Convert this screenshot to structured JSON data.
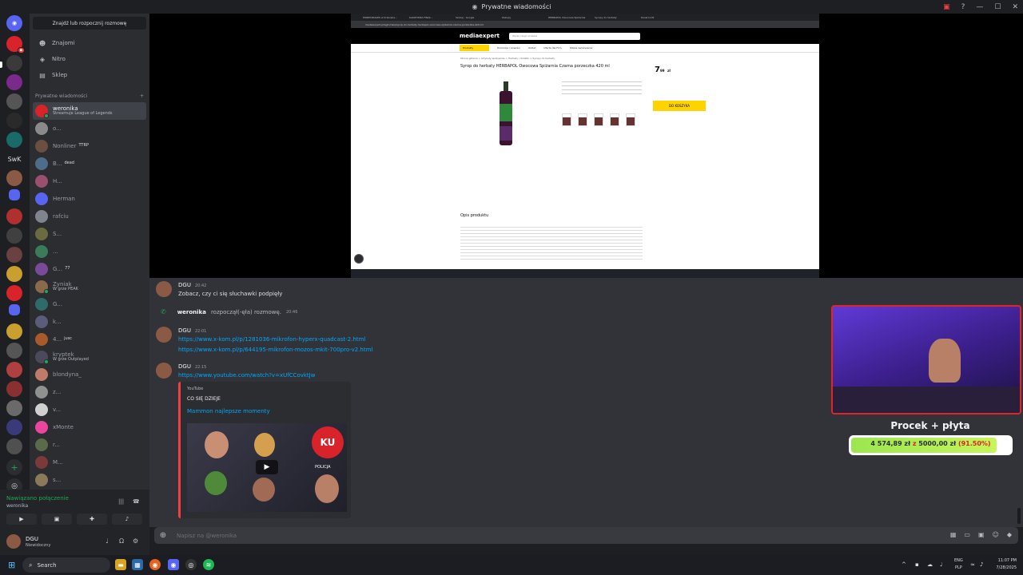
{
  "window": {
    "title": "Prywatne wiadomości"
  },
  "sidebar": {
    "search_label": "Znajdź lub rozpocznij rozmowę",
    "nav": [
      {
        "label": "Znajomi",
        "icon": "friends-icon"
      },
      {
        "label": "Nitro",
        "icon": "nitro-icon"
      },
      {
        "label": "Sklep",
        "icon": "shop-icon"
      }
    ],
    "dm_header": "Prywatne wiadomości",
    "dms": [
      {
        "name": "weronika",
        "sub": "Streamuje League of Legends",
        "active": true,
        "color": "#d8232a"
      },
      {
        "name": "o...",
        "color": "#8a8a8a"
      },
      {
        "name": "Nonliner",
        "tag": "TTRP",
        "color": "#6b4f3f"
      },
      {
        "name": "B...",
        "tag": "dead",
        "color": "#4e6d8a"
      },
      {
        "name": "H...",
        "color": "#9a4f6e"
      },
      {
        "name": "Herman",
        "color": "#5865f2"
      },
      {
        "name": "rafciu",
        "color": "#80848e"
      },
      {
        "name": "S...",
        "color": "#6b6b40"
      },
      {
        "name": "...",
        "color": "#3b7b5a"
      },
      {
        "name": "G...",
        "tag": "77",
        "color": "#7a4a9a"
      },
      {
        "name": "Zyniak",
        "sub": "W grze PEAK",
        "color": "#8a6a4a"
      },
      {
        "name": "G...",
        "color": "#2e6b6b"
      },
      {
        "name": "k...",
        "color": "#5b5b7a"
      },
      {
        "name": "4...",
        "tag": "jusc",
        "color": "#a85a2a"
      },
      {
        "name": "kryptek",
        "sub": "W grze Outplayed",
        "color": "#4a4a5a"
      },
      {
        "name": "blondyna_",
        "color": "#c07a6a"
      },
      {
        "name": "z...",
        "color": "#909090"
      },
      {
        "name": "v...",
        "color": "#d0d0d0"
      },
      {
        "name": "xMonte",
        "color": "#eb459e"
      },
      {
        "name": "r...",
        "color": "#5a6a4a"
      },
      {
        "name": "M...",
        "color": "#7a3a3a"
      },
      {
        "name": "s...",
        "color": "#8a7a5a"
      }
    ]
  },
  "voice": {
    "status": "Nawiązano połączenie",
    "channel": "weronika"
  },
  "user": {
    "name": "DGU",
    "status": "Niewidoczny"
  },
  "stream": {
    "tabs": [
      "PONIEDZIAŁEK w Krakowie...",
      "KAKOFONIA FINAŁ...",
      "Szukaj - Google",
      "Zakupy",
      "HERBAPOL Owocowa Spiżarnia",
      "Syropy do herbaty",
      "Kanał Łódź"
    ],
    "url": "mediaexpert.pl/agd-male/syrop-do-herbaty-herbapol-owocowa-spizarnia-czarna-porzeczka-420-ml",
    "shop": {
      "logo": "mediaexpert",
      "search_placeholder": "Wpisz czego szukasz",
      "category_button": "Produkty",
      "nav": [
        "Promocje i nowości",
        "Outlet",
        "Oferta dla Firm",
        "Status zamówienia"
      ],
      "breadcrumb": "Strona główna > Artykuły spożywcze > Herbaty i dodatki > Syropy do herbaty",
      "product_title": "Syrop do herbaty HERBAPOL Owocowa Spiżarnia Czarna porzeczka 420 ml",
      "price": "7",
      "price_cents": "99",
      "price_currency": "zł",
      "cart_button": "DO KOSZYKA",
      "description_title": "Opis produktu"
    }
  },
  "chat": {
    "messages": [
      {
        "author": "DGU",
        "time": "20:42",
        "text": "Zobacz, czy ci się słuchawki podpięły"
      },
      {
        "author": "DGU",
        "time": "22:01",
        "links": [
          "https://www.x-kom.pl/p/1281036-mikrofon-hyperx-quadcast-2.html",
          "https://www.x-kom.pl/p/644195-mikrofon-mozos-mkit-700pro-v2.html"
        ]
      },
      {
        "author": "DGU",
        "time": "22:15",
        "links": [
          "https://www.youtube.com/watch?v=xUfCCovktJw"
        ]
      }
    ],
    "call": {
      "who": "weronika",
      "text": "rozpoczął(-ęła) rozmowę.",
      "time": "20:46"
    },
    "embed": {
      "provider": "YouTube",
      "author": "CO SIĘ DZIEJE",
      "title": "Mammon najlepsze momenty",
      "logo_text": "KU",
      "badge": "POLICJA"
    },
    "composer_placeholder": "Napisz na @weronika"
  },
  "overlay": {
    "goal_title": "Procek + płyta",
    "current": "4 574,89 zł",
    "separator": "z",
    "target": "5000,00 zł",
    "percent": "(91.50%)",
    "progress": 0.915,
    "accent": "#9be650"
  },
  "taskbar": {
    "search_label": "Search",
    "lang_top": "ENG",
    "lang_bottom": "PLP",
    "time": "11:07 PM",
    "date": "7/28/2025"
  }
}
